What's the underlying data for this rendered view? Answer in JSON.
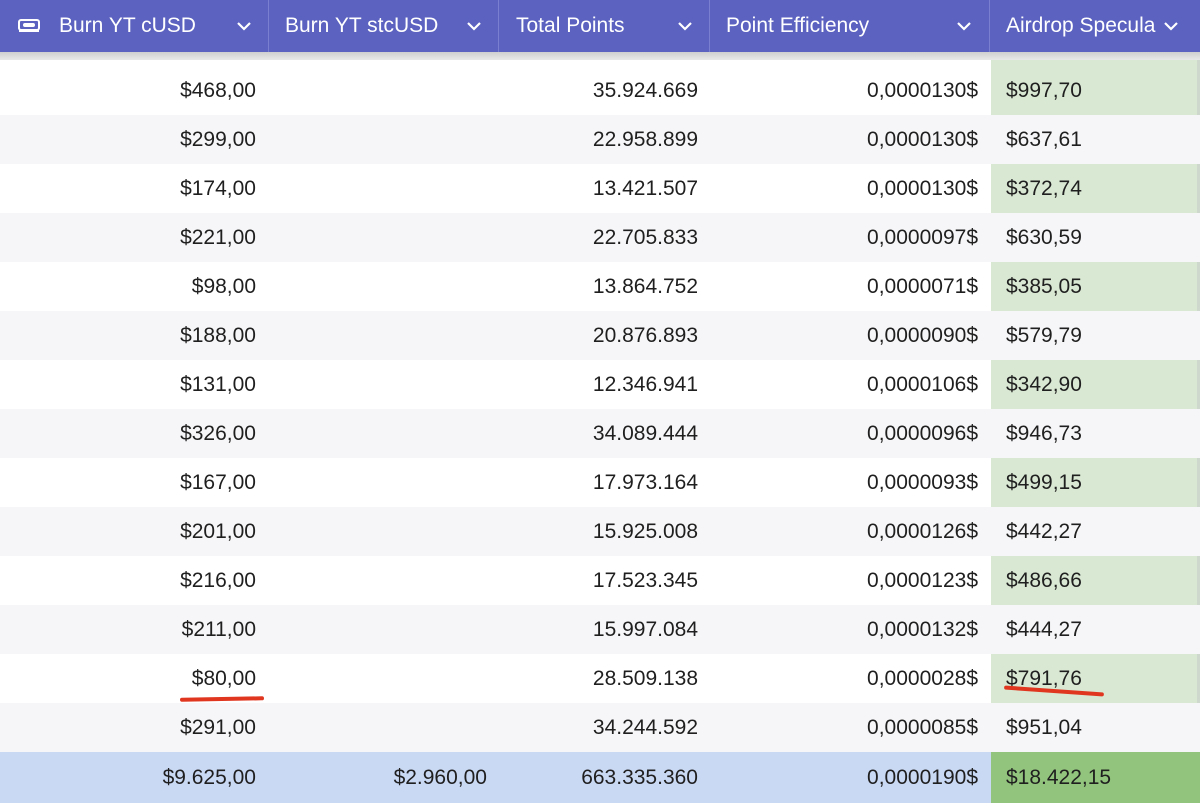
{
  "header": {
    "columns": [
      {
        "label": "Burn YT cUSD"
      },
      {
        "label": "Burn YT stcUSD"
      },
      {
        "label": "Total Points"
      },
      {
        "label": "Point Efficiency"
      },
      {
        "label": "Airdrop Specula"
      }
    ]
  },
  "rows": [
    {
      "burn_cusd": "$468,00",
      "burn_stcusd": "",
      "total_points": "35.924.669",
      "efficiency": "0,0000130$",
      "airdrop": "$997,70"
    },
    {
      "burn_cusd": "$299,00",
      "burn_stcusd": "",
      "total_points": "22.958.899",
      "efficiency": "0,0000130$",
      "airdrop": "$637,61"
    },
    {
      "burn_cusd": "$174,00",
      "burn_stcusd": "",
      "total_points": "13.421.507",
      "efficiency": "0,0000130$",
      "airdrop": "$372,74"
    },
    {
      "burn_cusd": "$221,00",
      "burn_stcusd": "",
      "total_points": "22.705.833",
      "efficiency": "0,0000097$",
      "airdrop": "$630,59"
    },
    {
      "burn_cusd": "$98,00",
      "burn_stcusd": "",
      "total_points": "13.864.752",
      "efficiency": "0,0000071$",
      "airdrop": "$385,05"
    },
    {
      "burn_cusd": "$188,00",
      "burn_stcusd": "",
      "total_points": "20.876.893",
      "efficiency": "0,0000090$",
      "airdrop": "$579,79"
    },
    {
      "burn_cusd": "$131,00",
      "burn_stcusd": "",
      "total_points": "12.346.941",
      "efficiency": "0,0000106$",
      "airdrop": "$342,90"
    },
    {
      "burn_cusd": "$326,00",
      "burn_stcusd": "",
      "total_points": "34.089.444",
      "efficiency": "0,0000096$",
      "airdrop": "$946,73"
    },
    {
      "burn_cusd": "$167,00",
      "burn_stcusd": "",
      "total_points": "17.973.164",
      "efficiency": "0,0000093$",
      "airdrop": "$499,15"
    },
    {
      "burn_cusd": "$201,00",
      "burn_stcusd": "",
      "total_points": "15.925.008",
      "efficiency": "0,0000126$",
      "airdrop": "$442,27"
    },
    {
      "burn_cusd": "$216,00",
      "burn_stcusd": "",
      "total_points": "17.523.345",
      "efficiency": "0,0000123$",
      "airdrop": "$486,66"
    },
    {
      "burn_cusd": "$211,00",
      "burn_stcusd": "",
      "total_points": "15.997.084",
      "efficiency": "0,0000132$",
      "airdrop": "$444,27"
    },
    {
      "burn_cusd": "$80,00",
      "burn_stcusd": "",
      "total_points": "28.509.138",
      "efficiency": "0,0000028$",
      "airdrop": "$791,76"
    },
    {
      "burn_cusd": "$291,00",
      "burn_stcusd": "",
      "total_points": "34.244.592",
      "efficiency": "0,0000085$",
      "airdrop": "$951,04"
    }
  ],
  "totals": {
    "burn_cusd": "$9.625,00",
    "burn_stcusd": "$2.960,00",
    "total_points": "663.335.360",
    "efficiency": "0,0000190$",
    "airdrop": "$18.422,15"
  },
  "colors": {
    "header_bg": "#5b62c0",
    "airdrop_column_bg": "#d9e8d3",
    "totals_row_bg": "#c9d8f3",
    "totals_airdrop_bg": "#93c47d",
    "annotation_underline": "#e0361f"
  },
  "icons": [
    "money-icon",
    "chevron-down-icon"
  ]
}
